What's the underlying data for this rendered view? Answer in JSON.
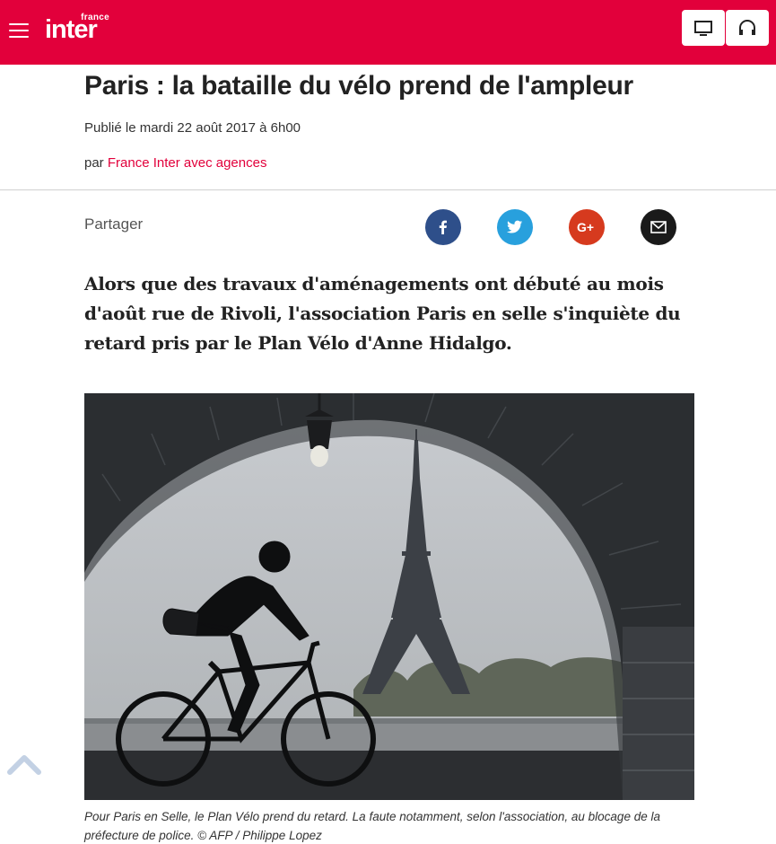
{
  "header": {
    "logo_small": "france",
    "logo_main": "inter",
    "brand_color": "#e2003b",
    "menu_icon": "hamburger-icon",
    "tv_icon": "tv-icon",
    "audio_icon": "headphones-icon"
  },
  "article": {
    "title": "Paris : la bataille du vélo prend de l'ampleur",
    "published": "Publié le mardi 22 août 2017 à 6h00",
    "author_prefix": "par ",
    "author": "France Inter avec agences",
    "lead": "Alors que des travaux d'aménagements ont débuté au mois d'août rue de Rivoli, l'association Paris en selle s'inquiète du retard pris par le Plan Vélo d'Anne Hidalgo.",
    "caption": "Pour Paris en Selle, le Plan Vélo prend du retard. La faute notamment, selon l'association, au blocage de la préfecture de police. © AFP / Philippe Lopez"
  },
  "share": {
    "label": "Partager",
    "buttons": [
      {
        "name": "facebook",
        "icon": "facebook-icon",
        "color": "#2e4f8a"
      },
      {
        "name": "twitter",
        "icon": "twitter-icon",
        "color": "#28a0dd"
      },
      {
        "name": "google-plus",
        "icon": "google-plus-icon",
        "color": "#d63a1e"
      },
      {
        "name": "email",
        "icon": "mail-icon",
        "color": "#1a1a1a"
      }
    ]
  },
  "scroll_top_icon": "chevron-up-icon"
}
